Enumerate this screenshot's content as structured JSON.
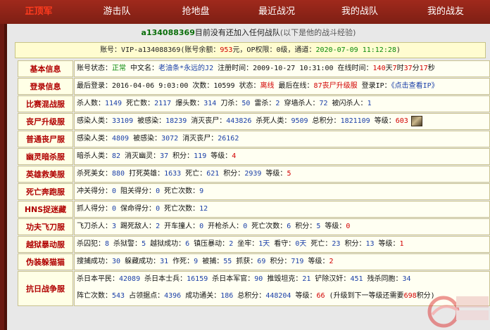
{
  "nav": {
    "brand": "正顶军",
    "items": [
      "游击队",
      "抢地盘",
      "最近战况",
      "我的战队",
      "我的战友"
    ]
  },
  "notice": {
    "user": "a134088369",
    "text": "目前没有还加入任何战队",
    "grey": "(以下是他的战斗经验)"
  },
  "account": {
    "prefix": "账号：VIP-a134088369(账号余额：",
    "balance": "953",
    "mid": "元，OP权限：0级，通道：",
    "date": "2020-07-09 11:12:28",
    "suffix": ")"
  },
  "rows": {
    "basic": {
      "label": "基本信息",
      "t1": "账号状态：",
      "status": "正常",
      "t2": " 中文名：",
      "name": "老油条*永远的J2",
      "t3": " 注册时间：2009-10-27 10:31:00 在线时间：",
      "d": "140",
      "t4": "天",
      "h": "7",
      "t5": "时",
      "m": "37",
      "t6": "分",
      "s": "17",
      "t7": "秒"
    },
    "login": {
      "label": "登录信息",
      "t1": "最后登录：2016-04-06 9:03:00 次数：10599 状态：",
      "state": "离线",
      "t2": " 最后在线：",
      "server": "87丧尸升级服",
      "t3": " 登录IP：",
      "ip": "《点击查看IP》"
    },
    "mix": {
      "label": "比赛混战服",
      "t1": "杀人数：",
      "v1": "1149",
      "t2": " 死亡数：",
      "v2": "2117",
      "t3": " 爆头数：",
      "v3": "314",
      "t4": " 刀杀：",
      "v4": "50",
      "t5": " 雷杀：",
      "v5": "2",
      "t6": " 穿墙杀人：",
      "v6": "72",
      "t7": " 被闪杀人：",
      "v7": "1"
    },
    "zombie_up": {
      "label": "丧尸升级服",
      "t1": "感染人类：",
      "v1": "33109",
      "t2": " 被感染：",
      "v2": "18239",
      "t3": " 消灭丧尸：",
      "v3": "443826",
      "t4": " 杀死人类：",
      "v4": "9509",
      "t5": " 总积分：",
      "v5": "1821109",
      "t6": " 等级：",
      "v6": "603"
    },
    "zombie_normal": {
      "label": "普通丧尸服",
      "t1": "感染人类：",
      "v1": "4809",
      "t2": " 被感染：",
      "v2": "3072",
      "t3": " 消灭丧尸：",
      "v3": "26162"
    },
    "ghost": {
      "label": "幽灵暗杀服",
      "t1": "暗杀人类：",
      "v1": "82",
      "t2": " 消灭幽灵：",
      "v2": "37",
      "t3": " 积分：",
      "v3": "119",
      "t4": " 等级：",
      "v4": "4"
    },
    "hero": {
      "label": "英雄救美服",
      "t1": "杀死美女：",
      "v1": "880",
      "t2": " 打死英雄：",
      "v2": "1633",
      "t3": " 死亡：",
      "v3": "621",
      "t4": " 积分：",
      "v4": "2939",
      "t5": " 等级：",
      "v5": "5"
    },
    "run": {
      "label": "死亡奔跑服",
      "t1": "冲关得分：",
      "v1": "0",
      "t2": " 阻关得分：",
      "v2": "0",
      "t3": " 死亡次数：",
      "v3": "9"
    },
    "hns": {
      "label": "HNS捉迷藏",
      "t1": "抓人得分：",
      "v1": "0",
      "t2": " 保命得分：",
      "v2": "0",
      "t3": " 死亡次数：",
      "v3": "12"
    },
    "kungfu": {
      "label": "功夫飞刀服",
      "t1": "飞刀杀人：",
      "v1": "3",
      "t2": " 踢死敌人：",
      "v2": "2",
      "t3": " 开车撞人：",
      "v3": "0",
      "t4": " 开枪杀人：",
      "v4": "0",
      "t5": " 死亡次数：",
      "v5": "6",
      "t6": " 积分：",
      "v6": "5",
      "t7": " 等级：",
      "v7": "0"
    },
    "jail": {
      "label": "越狱暴动服",
      "t1": "杀囚犯：",
      "v1": "8",
      "t2": " 杀狱警：",
      "v2": "5",
      "t3": " 越狱成功：",
      "v3": "6",
      "t4": " 镇压暴动：",
      "v4": "2",
      "t5": " 坐牢：",
      "v5": "1天",
      "t6": " 看守：",
      "v6": "0天",
      "t7": " 死亡：",
      "v7": "23",
      "t8": " 积分：",
      "v8": "13",
      "t9": " 等级：",
      "v9": "1"
    },
    "disguise": {
      "label": "伪装躲猫猫",
      "t1": "搜捕成功：",
      "v1": "30",
      "t2": " 躲藏成功：",
      "v2": "31",
      "t3": " 作死：",
      "v3": "9",
      "t4": " 被捕：",
      "v4": "55",
      "t5": " 抓获：",
      "v5": "69",
      "t6": " 积分：",
      "v6": "719",
      "t7": " 等级：",
      "v7": "2"
    },
    "war": {
      "label": "抗日战争服",
      "l1": {
        "t1": "杀日本平民：",
        "v1": "42089",
        "t2": " 杀日本士兵：",
        "v2": "16159",
        "t3": " 杀日本军官：",
        "v3": "90",
        "t4": " 推毁坦克：",
        "v4": "21",
        "t5": " 铲除汉奸：",
        "v5": "451",
        "t6": " 残杀同胞：",
        "v6": "34"
      },
      "l2": {
        "t1": "阵亡次数：",
        "v1": "543",
        "t2": " 占领据点：",
        "v2": "4396",
        "t3": " 成功通关：",
        "v3": "186",
        "t4": " 总积分：",
        "v4": "448204",
        "t5": " 等级：",
        "v5": "66",
        "t6": " (升级到下一等级还需要",
        "v6": "698",
        "t7": "积分)"
      }
    }
  },
  "colors": {
    "nav": "#8e2417",
    "label": "#b00000",
    "value": "#1a3fa8",
    "highlight": "#d20000",
    "ok": "#0a8a0a"
  }
}
